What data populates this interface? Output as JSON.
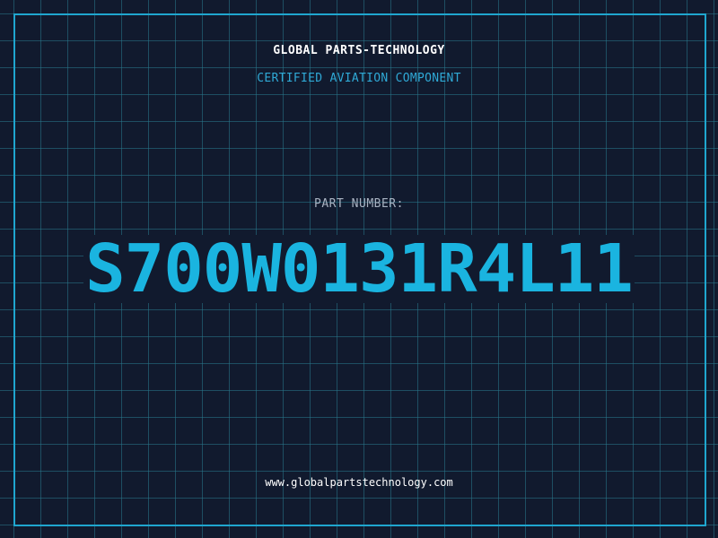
{
  "header": {
    "company": "GLOBAL PARTS-TECHNOLOGY",
    "subtitle": "CERTIFIED AVIATION COMPONENT"
  },
  "part": {
    "label": "PART NUMBER:",
    "number": "S700W0131R4L11"
  },
  "footer": {
    "url": "www.globalpartstechnology.com"
  },
  "colors": {
    "background": "#111a2e",
    "grid": "#28788c",
    "frame": "#1fa6cf",
    "accent": "#1ab4e0",
    "label": "#a9b3c2"
  }
}
